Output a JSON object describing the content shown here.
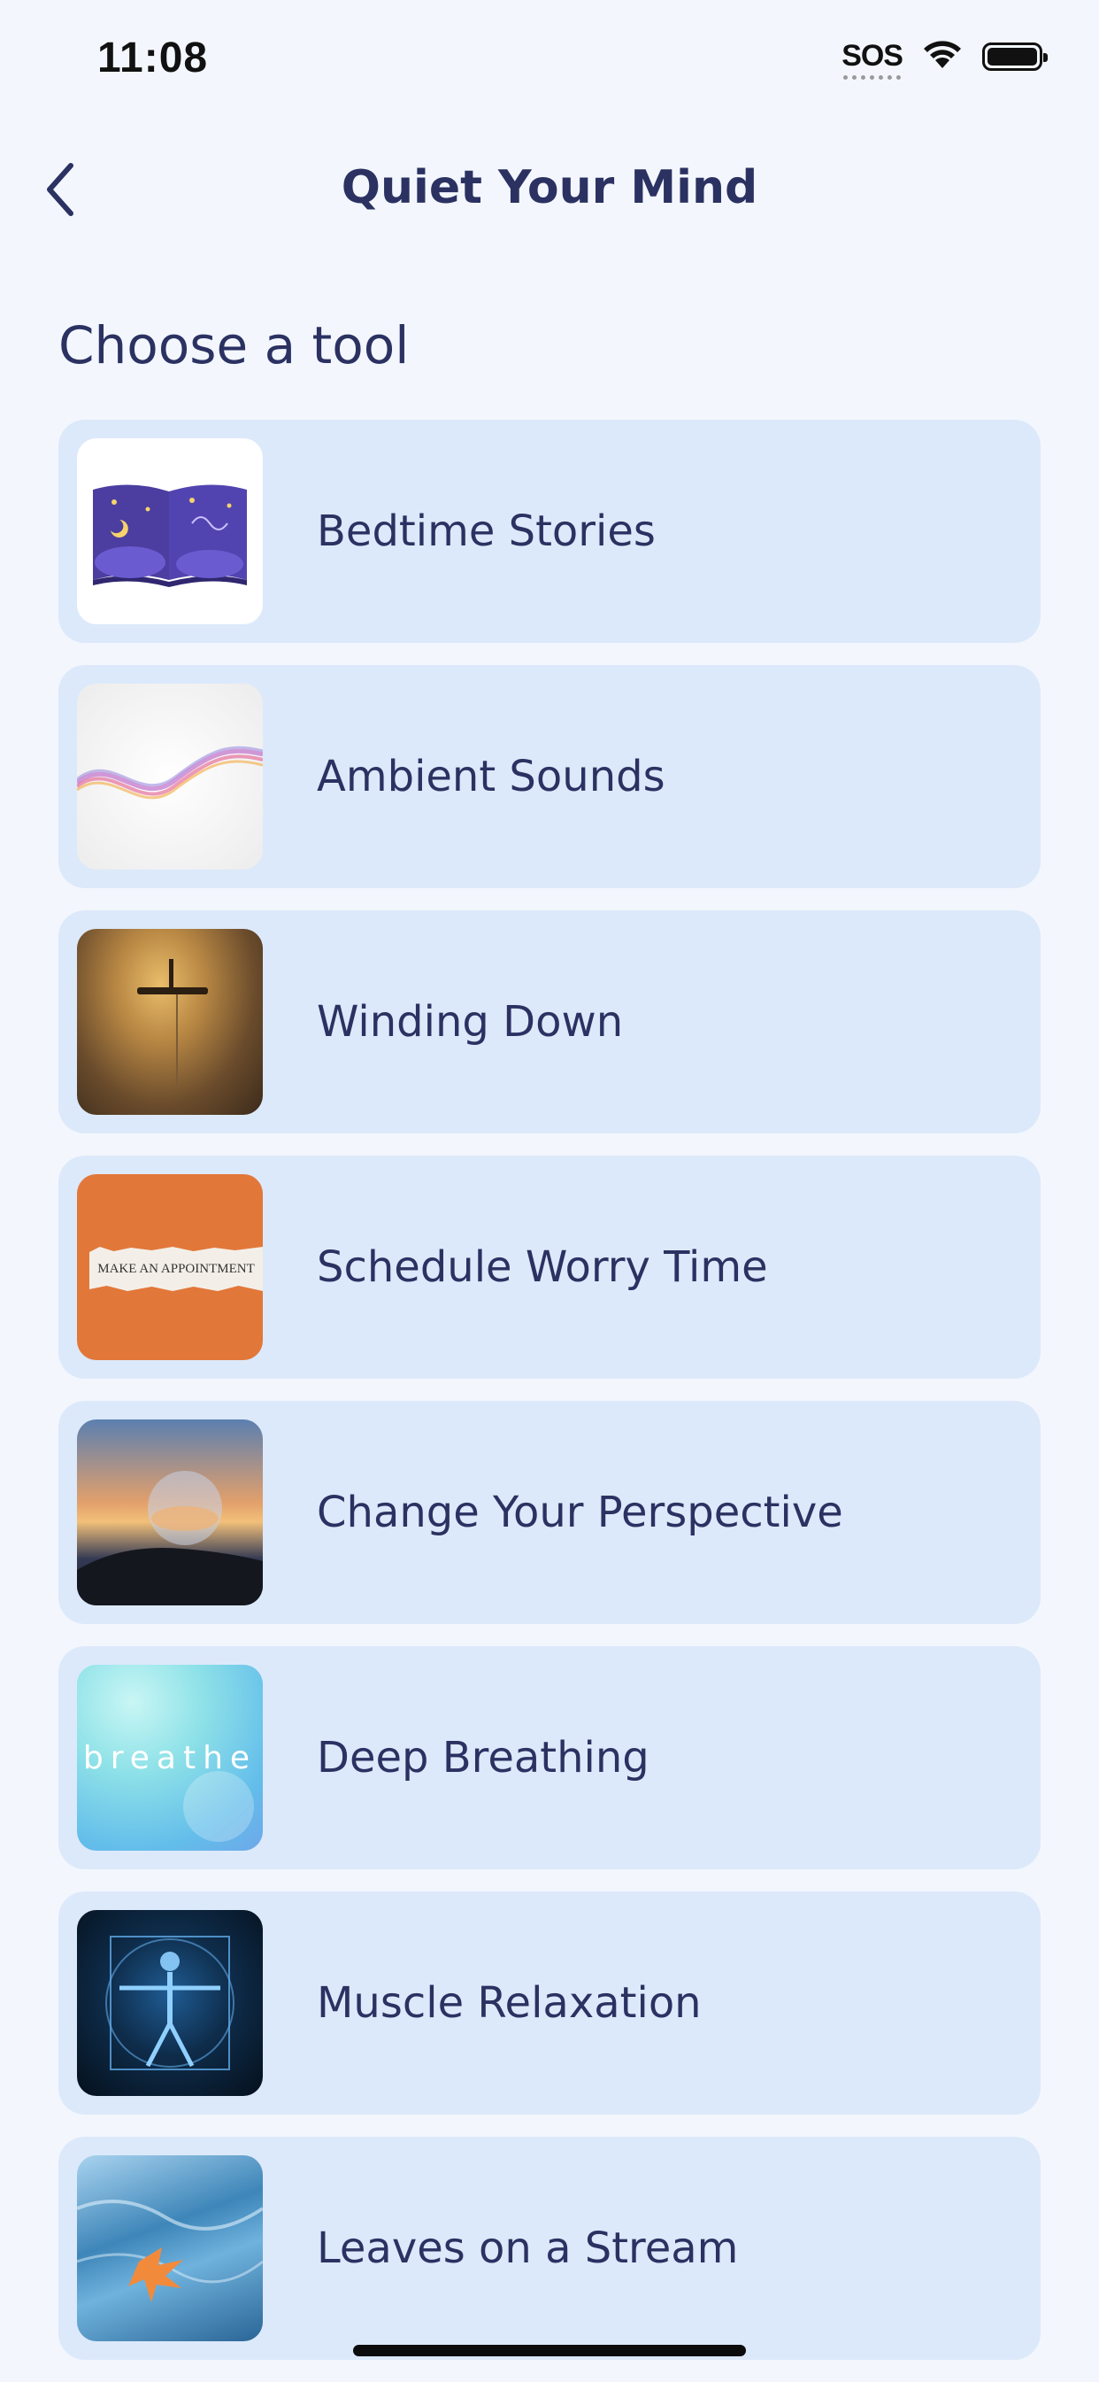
{
  "status_bar": {
    "time": "11:08",
    "sos": "SOS",
    "wifi_icon": "wifi-icon",
    "battery_icon": "battery-icon"
  },
  "header": {
    "back_icon": "chevron-left-icon",
    "title": "Quiet Your Mind"
  },
  "section_title": "Choose a tool",
  "tools": [
    {
      "label": "Bedtime Stories",
      "thumbnail": "storybook-illustration"
    },
    {
      "label": "Ambient Sounds",
      "thumbnail": "sound-wave-ribbon"
    },
    {
      "label": "Winding Down",
      "thumbnail": "wall-lamp-glow"
    },
    {
      "label": "Schedule Worry Time",
      "thumbnail": "torn-paper-note",
      "thumbnail_text": "MAKE AN APPOINTMENT"
    },
    {
      "label": "Change Your Perspective",
      "thumbnail": "crystal-ball-sunset"
    },
    {
      "label": "Deep Breathing",
      "thumbnail": "breathe-bokeh",
      "thumbnail_text": "breathe"
    },
    {
      "label": "Muscle Relaxation",
      "thumbnail": "vitruvian-figure"
    },
    {
      "label": "Leaves on a Stream",
      "thumbnail": "leaf-in-water"
    }
  ],
  "colors": {
    "background": "#f3f7fd",
    "card": "#dce9fa",
    "text": "#2b3262"
  }
}
